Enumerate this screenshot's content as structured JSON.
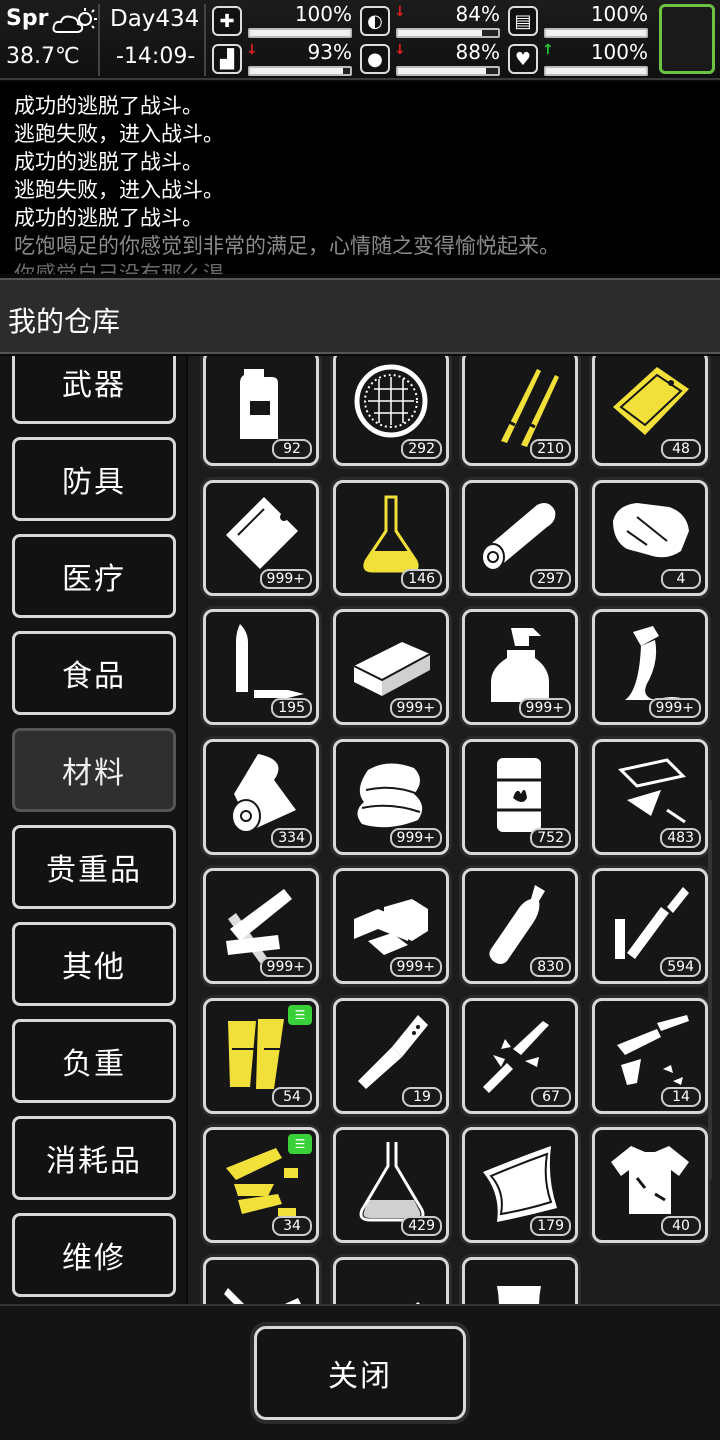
{
  "status": {
    "season": "Spr",
    "temperature": "38.7℃",
    "day": "Day434",
    "time": "-14:09-",
    "stats": [
      {
        "icon": "medkit-icon",
        "glyph": "✚",
        "value": "100%",
        "level": 1.0,
        "arrow": "",
        "arrow_color": ""
      },
      {
        "icon": "stomach-icon",
        "glyph": "◐",
        "value": "84%",
        "level": 0.84,
        "arrow": "↓",
        "arrow_color": "#e02020"
      },
      {
        "icon": "stamina-icon",
        "glyph": "▤",
        "value": "100%",
        "level": 1.0,
        "arrow": "",
        "arrow_color": ""
      },
      {
        "icon": "boot-icon",
        "glyph": "▟",
        "value": "93%",
        "level": 0.93,
        "arrow": "↓",
        "arrow_color": "#e02020"
      },
      {
        "icon": "water-drop-icon",
        "glyph": "●",
        "value": "88%",
        "level": 0.88,
        "arrow": "↓",
        "arrow_color": "#e02020"
      },
      {
        "icon": "heart-icon",
        "glyph": "♥",
        "value": "100%",
        "level": 1.0,
        "arrow": "↑",
        "arrow_color": "#22cc33"
      }
    ],
    "portrait_color": "#6ec241"
  },
  "log": [
    "成功的逃脱了战斗。",
    "逃跑失败，进入战斗。",
    "成功的逃脱了战斗。",
    "逃跑失败，进入战斗。",
    "成功的逃脱了战斗。",
    "吃饱喝足的你感觉到非常的满足，心情随之变得愉悦起来。",
    "你感觉自己没有那么渴"
  ],
  "window": {
    "title": "我的仓库",
    "close_label": "关闭"
  },
  "tabs": [
    {
      "label": "武器",
      "active": false
    },
    {
      "label": "防具",
      "active": false
    },
    {
      "label": "医疗",
      "active": false
    },
    {
      "label": "食品",
      "active": false
    },
    {
      "label": "材料",
      "active": true
    },
    {
      "label": "贵重品",
      "active": false
    },
    {
      "label": "其他",
      "active": false
    },
    {
      "label": "负重",
      "active": false
    },
    {
      "label": "消耗品",
      "active": false
    },
    {
      "label": "维修",
      "active": false
    }
  ],
  "items": [
    {
      "icon": "jerry-can-icon",
      "count": "92",
      "color": "#ffffff",
      "tag": false
    },
    {
      "icon": "filter-mesh-icon",
      "count": "292",
      "color": "#ffffff",
      "tag": false
    },
    {
      "icon": "blades-icon",
      "count": "210",
      "color": "#f2e03a",
      "tag": false
    },
    {
      "icon": "gold-plate-icon",
      "count": "48",
      "color": "#f2e03a",
      "tag": false
    },
    {
      "icon": "plastic-bag-icon",
      "count": "999+",
      "color": "#ffffff",
      "tag": false
    },
    {
      "icon": "flask-icon",
      "count": "146",
      "color": "#f2e03a",
      "tag": false
    },
    {
      "icon": "log-icon",
      "count": "297",
      "color": "#ffffff",
      "tag": false
    },
    {
      "icon": "leather-icon",
      "count": "4",
      "color": "#ffffff",
      "tag": false
    },
    {
      "icon": "bullet-icon",
      "count": "195",
      "color": "#ffffff",
      "tag": false
    },
    {
      "icon": "brick-icon",
      "count": "999+",
      "color": "#ffffff",
      "tag": false
    },
    {
      "icon": "spray-bottle-icon",
      "count": "999+",
      "color": "#ffffff",
      "tag": false
    },
    {
      "icon": "glue-tube-icon",
      "count": "999+",
      "color": "#ffffff",
      "tag": false
    },
    {
      "icon": "cloth-roll-icon",
      "count": "334",
      "color": "#ffffff",
      "tag": false
    },
    {
      "icon": "fabric-pile-icon",
      "count": "999+",
      "color": "#ffffff",
      "tag": false
    },
    {
      "icon": "fuel-barrel-icon",
      "count": "752",
      "color": "#ffffff",
      "tag": false
    },
    {
      "icon": "glass-shards-icon",
      "count": "483",
      "color": "#ffffff",
      "tag": false
    },
    {
      "icon": "planks-icon",
      "count": "999+",
      "color": "#ffffff",
      "tag": false
    },
    {
      "icon": "wood-blocks-icon",
      "count": "999+",
      "color": "#ffffff",
      "tag": false
    },
    {
      "icon": "bottle-icon",
      "count": "830",
      "color": "#ffffff",
      "tag": false
    },
    {
      "icon": "pipe-parts-icon",
      "count": "594",
      "color": "#ffffff",
      "tag": false
    },
    {
      "icon": "gold-boards-icon",
      "count": "54",
      "color": "#f2e03a",
      "tag": true
    },
    {
      "icon": "metal-pipe-icon",
      "count": "19",
      "color": "#ffffff",
      "tag": false
    },
    {
      "icon": "weapon-parts-icon",
      "count": "67",
      "color": "#ffffff",
      "tag": false
    },
    {
      "icon": "gun-parts-icon",
      "count": "14",
      "color": "#ffffff",
      "tag": false
    },
    {
      "icon": "gold-parts-icon",
      "count": "34",
      "color": "#f2e03a",
      "tag": true
    },
    {
      "icon": "beaker-icon",
      "count": "429",
      "color": "#ffffff",
      "tag": false
    },
    {
      "icon": "cloth-sheet-icon",
      "count": "179",
      "color": "#ffffff",
      "tag": false
    },
    {
      "icon": "torn-shirt-icon",
      "count": "40",
      "color": "#ffffff",
      "tag": false
    },
    {
      "icon": "scissors-icon",
      "count": "",
      "color": "#ffffff",
      "tag": false
    },
    {
      "icon": "tube-icon",
      "count": "",
      "color": "#ffffff",
      "tag": false
    },
    {
      "icon": "sack-icon",
      "count": "",
      "color": "#ffffff",
      "tag": false
    }
  ]
}
